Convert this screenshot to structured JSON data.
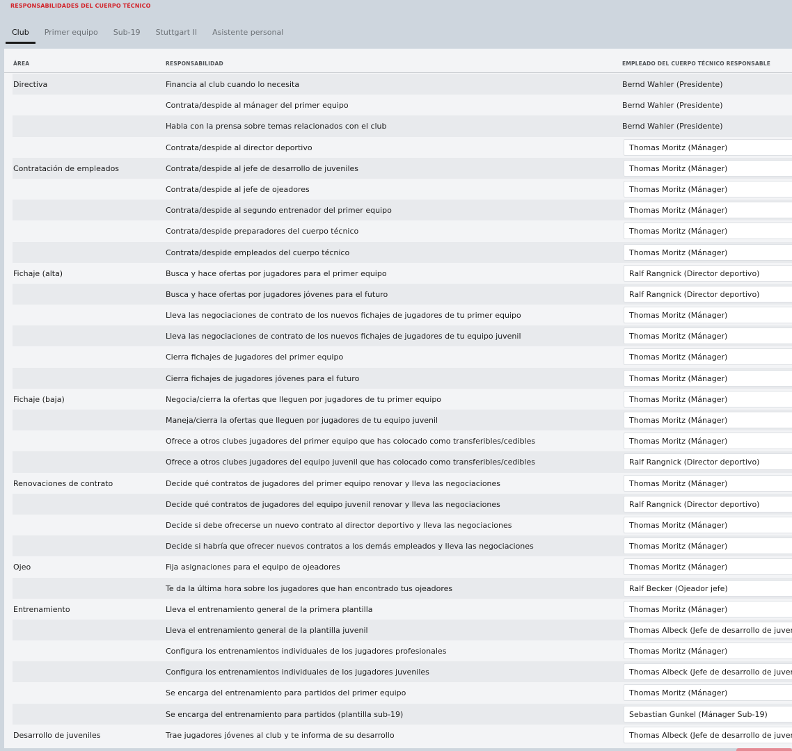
{
  "page": {
    "title": "RESPONSABILIDADES DEL CUERPO TÉCNICO"
  },
  "tabs": [
    {
      "label": "Club",
      "active": true
    },
    {
      "label": "Primer equipo",
      "active": false
    },
    {
      "label": "Sub-19",
      "active": false
    },
    {
      "label": "Stuttgart II",
      "active": false
    },
    {
      "label": "Asistente personal",
      "active": false
    }
  ],
  "table": {
    "headers": {
      "area": "ÁREA",
      "responsibility": "RESPONSABILIDAD",
      "employee": "EMPLEADO DEL CUERPO TÉCNICO RESPONSABLE"
    },
    "rows": [
      {
        "area": "Directiva",
        "responsibility": "Financia al club cuando lo necesita",
        "employee": "Bernd Wahler (Presidente)",
        "editable": false
      },
      {
        "area": "",
        "responsibility": "Contrata/despide al mánager del primer equipo",
        "employee": "Bernd Wahler (Presidente)",
        "editable": false
      },
      {
        "area": "",
        "responsibility": "Habla con la prensa sobre temas relacionados con el club",
        "employee": "Bernd Wahler (Presidente)",
        "editable": false
      },
      {
        "area": "",
        "responsibility": "Contrata/despide al director deportivo",
        "employee": "Thomas Moritz (Mánager)",
        "editable": true
      },
      {
        "area": "Contratación de empleados",
        "responsibility": "Contrata/despide al jefe de desarrollo de juveniles",
        "employee": "Thomas Moritz (Mánager)",
        "editable": true
      },
      {
        "area": "",
        "responsibility": "Contrata/despide al jefe de ojeadores",
        "employee": "Thomas Moritz (Mánager)",
        "editable": true
      },
      {
        "area": "",
        "responsibility": "Contrata/despide al segundo entrenador del primer equipo",
        "employee": "Thomas Moritz (Mánager)",
        "editable": true
      },
      {
        "area": "",
        "responsibility": "Contrata/despide preparadores del cuerpo técnico",
        "employee": "Thomas Moritz (Mánager)",
        "editable": true
      },
      {
        "area": "",
        "responsibility": "Contrata/despide empleados del cuerpo técnico",
        "employee": "Thomas Moritz (Mánager)",
        "editable": true
      },
      {
        "area": "Fichaje (alta)",
        "responsibility": "Busca y hace ofertas por jugadores para el primer equipo",
        "employee": "Ralf Rangnick (Director deportivo)",
        "editable": true
      },
      {
        "area": "",
        "responsibility": "Busca y hace ofertas por jugadores jóvenes para el futuro",
        "employee": "Ralf Rangnick (Director deportivo)",
        "editable": true
      },
      {
        "area": "",
        "responsibility": "Lleva las negociaciones de contrato de los nuevos fichajes de jugadores de tu primer equipo",
        "employee": "Thomas Moritz (Mánager)",
        "editable": true
      },
      {
        "area": "",
        "responsibility": "Lleva las negociaciones de contrato de los nuevos fichajes de jugadores de tu equipo juvenil",
        "employee": "Thomas Moritz (Mánager)",
        "editable": true
      },
      {
        "area": "",
        "responsibility": "Cierra fichajes de jugadores del primer equipo",
        "employee": "Thomas Moritz (Mánager)",
        "editable": true
      },
      {
        "area": "",
        "responsibility": "Cierra fichajes de jugadores jóvenes para el futuro",
        "employee": "Thomas Moritz (Mánager)",
        "editable": true
      },
      {
        "area": "Fichaje (baja)",
        "responsibility": "Negocia/cierra la ofertas que lleguen por jugadores de tu primer equipo",
        "employee": "Thomas Moritz (Mánager)",
        "editable": true
      },
      {
        "area": "",
        "responsibility": "Maneja/cierra la ofertas que lleguen por jugadores de tu equipo juvenil",
        "employee": "Thomas Moritz (Mánager)",
        "editable": true
      },
      {
        "area": "",
        "responsibility": "Ofrece a otros clubes jugadores del primer equipo que has colocado como transferibles/cedibles",
        "employee": "Thomas Moritz (Mánager)",
        "editable": true
      },
      {
        "area": "",
        "responsibility": "Ofrece a otros clubes jugadores del equipo juvenil que has colocado como transferibles/cedibles",
        "employee": "Ralf Rangnick (Director deportivo)",
        "editable": true
      },
      {
        "area": "Renovaciones de contrato",
        "responsibility": "Decide qué contratos de jugadores del primer equipo renovar y lleva las negociaciones",
        "employee": "Thomas Moritz (Mánager)",
        "editable": true
      },
      {
        "area": "",
        "responsibility": "Decide qué contratos de jugadores del equipo juvenil renovar y lleva las negociaciones",
        "employee": "Ralf Rangnick (Director deportivo)",
        "editable": true
      },
      {
        "area": "",
        "responsibility": "Decide si debe ofrecerse un nuevo contrato al director deportivo y lleva las negociaciones",
        "employee": "Thomas Moritz (Mánager)",
        "editable": true
      },
      {
        "area": "",
        "responsibility": "Decide si habría que ofrecer nuevos contratos a los demás empleados y lleva las negociaciones",
        "employee": "Thomas Moritz (Mánager)",
        "editable": true
      },
      {
        "area": "Ojeo",
        "responsibility": "Fija asignaciones para el equipo de ojeadores",
        "employee": "Thomas Moritz (Mánager)",
        "editable": true
      },
      {
        "area": "",
        "responsibility": "Te da la última hora sobre los jugadores que han encontrado tus ojeadores",
        "employee": "Ralf Becker (Ojeador jefe)",
        "editable": true
      },
      {
        "area": "Entrenamiento",
        "responsibility": "Lleva el entrenamiento general de la primera plantilla",
        "employee": "Thomas Moritz (Mánager)",
        "editable": true
      },
      {
        "area": "",
        "responsibility": "Lleva el entrenamiento general de la plantilla juvenil",
        "employee": "Thomas Albeck (Jefe de desarrollo de juveniles)",
        "editable": true
      },
      {
        "area": "",
        "responsibility": "Configura los entrenamientos individuales de los jugadores profesionales",
        "employee": "Thomas Moritz (Mánager)",
        "editable": true
      },
      {
        "area": "",
        "responsibility": "Configura los entrenamientos individuales de los jugadores juveniles",
        "employee": "Thomas Albeck (Jefe de desarrollo de juveniles)",
        "editable": true
      },
      {
        "area": "",
        "responsibility": "Se encarga del entrenamiento para partidos del primer equipo",
        "employee": "Thomas Moritz (Mánager)",
        "editable": true
      },
      {
        "area": "",
        "responsibility": "Se encarga del entrenamiento para partidos (plantilla sub-19)",
        "employee": "Sebastian Gunkel (Mánager Sub-19)",
        "editable": true
      },
      {
        "area": "Desarrollo de juveniles",
        "responsibility": "Trae jugadores jóvenes al club y te informa de su desarrollo",
        "employee": "Thomas Albeck (Jefe de desarrollo de juveniles)",
        "editable": true
      }
    ]
  },
  "colors": {
    "title_red": "#d2232a",
    "header_bg": "#ced6de",
    "panel_bg": "#f3f4f6",
    "stripe_bg": "#e8eaed"
  }
}
